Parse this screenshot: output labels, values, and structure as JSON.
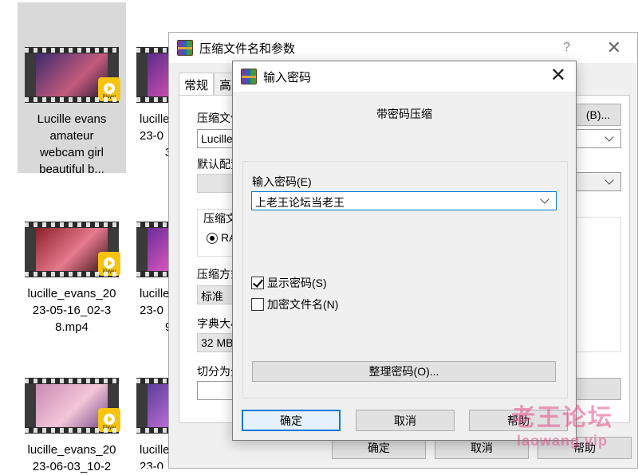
{
  "desktop": {
    "files": [
      {
        "name": "Lucille evans amateur webcam girl beautiful b…",
        "badge": "Player"
      },
      {
        "name": "lucille_evans_2023-0…",
        "badge": "Player"
      },
      {
        "name": "lucille_evans_2023-05-16_02-38.mp4",
        "badge": "Player"
      },
      {
        "name": "lucille_evans_2023-0…",
        "badge": "Player"
      },
      {
        "name": "lucille_evans_2023-06-03_10-2",
        "badge": "Player"
      },
      {
        "name": "lucille_evans_2023-0",
        "badge": "Player"
      }
    ],
    "file_labels": {
      "f1": [
        "Lucille evans",
        "amateur",
        "webcam girl",
        "beautiful b..."
      ],
      "f2": [
        "lucille",
        "23-0",
        "3"
      ],
      "f3": [
        "lucille_evans_20",
        "23-05-16_02-3",
        "8.mp4"
      ],
      "f4": [
        "lucille",
        "23-0",
        "9"
      ],
      "f5": [
        "lucille_evans_20",
        "23-06-03_10-2"
      ],
      "f6": [
        "lucille",
        "23-0"
      ]
    }
  },
  "back_window": {
    "title": "压缩文件名和参数",
    "help": "?",
    "close": "✕",
    "tabs": [
      "常规",
      "高"
    ],
    "archive_name_label": "压缩文件",
    "archive_name_value": "Lucille",
    "browse_button": "(B)...",
    "default_profile_label": "默认配置",
    "format_group_label": "压缩文",
    "format_radio_label": "RA",
    "method_label": "压缩方式",
    "method_value": "标准",
    "dict_label": "字典大小",
    "dict_value": "32 MB",
    "split_label": "切分为分",
    "ok_button": "确定",
    "cancel_button": "取消",
    "help_button": "帮助"
  },
  "password_dialog": {
    "title": "输入密码",
    "close": "✕",
    "heading": "带密码压缩",
    "enter_label": "输入密码(E)",
    "password_value": "上老王论坛当老王",
    "show_password_label": "显示密码(S)",
    "show_password_checked": true,
    "encrypt_names_label": "加密文件名(N)",
    "encrypt_names_checked": false,
    "organize_button": "整理密码(O)...",
    "ok_button": "确定",
    "cancel_button": "取消",
    "help_button": "帮助"
  },
  "watermark": {
    "cn": "老王论坛",
    "url": "laowang.vip"
  },
  "colors": {
    "accent": "#0078d7",
    "dialog_bg": "#f0f0f0",
    "badge": "#f6c40e",
    "watermark": "#e6508a"
  }
}
